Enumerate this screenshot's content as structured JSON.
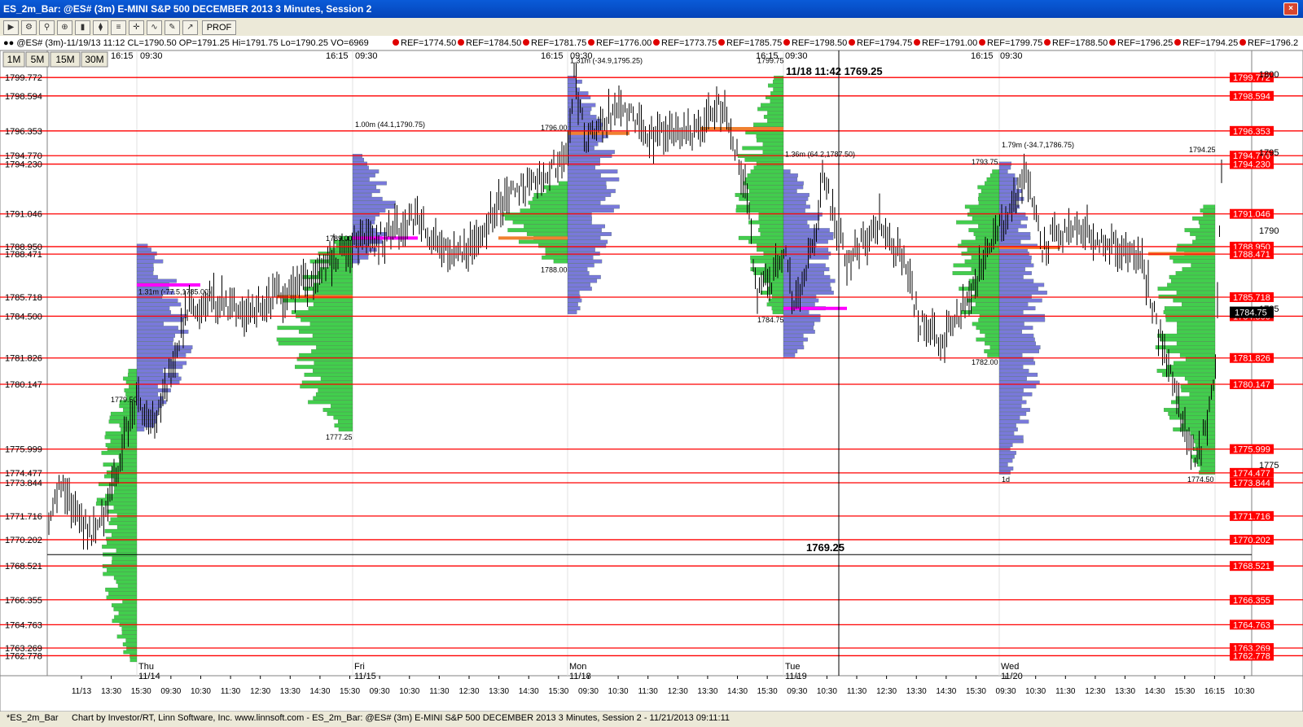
{
  "window": {
    "title": "ES_2m_Bar: @ES# (3m) E-MINI S&P 500 DECEMBER 2013 3 Minutes, Session 2",
    "close": "×"
  },
  "toolbar": {
    "icons": [
      "play-icon",
      "gear-icon",
      "search-icon",
      "magnify-icon",
      "bar-chart-icon",
      "candle-icon",
      "profile-icon",
      "crosshair-icon",
      "line-chart-icon",
      "draw-icon",
      "trend-icon"
    ],
    "prof_label": "PROF"
  },
  "chart": {
    "info_bar": "@ES# (3m)-11/19/13 11:12 CL=1790.50 OP=1791.25 Hi=1791.75 Lo=1790.25 VO=6969",
    "ref_labels": [
      "REF=1774.50",
      "REF=1784.50",
      "REF=1781.75",
      "REF=1776.00",
      "REF=1773.75",
      "REF=1785.75",
      "REF=1798.50",
      "REF=1794.75",
      "REF=1791.00",
      "REF=1799.75",
      "REF=1788.50",
      "REF=1796.25",
      "REF=1794.25",
      "REF=1796.2"
    ],
    "period_buttons": [
      "1M",
      "5M",
      "15M",
      "30M"
    ],
    "ylim": [
      1761.5,
      1801.5
    ],
    "colors": {
      "background": "#ffffff",
      "price_line": "#ff0000",
      "bars": "#000000",
      "profile_green": "#2ec83a",
      "profile_blue": "#6b6bd6",
      "poc_magenta": "#ff00ff",
      "value_area_orange": "#f08030",
      "highlight_label_bg": "#ff0000"
    },
    "levels_left": [
      "1799.772",
      "1798.594",
      "1796.353",
      "1794.770",
      "1794.230",
      "1791.046",
      "1788.950",
      "1788.471",
      "1785.718",
      "1784.500",
      "1781.826",
      "1780.147",
      "1775.999",
      "1774.477",
      "1773.844",
      "1771.716",
      "1770.202",
      "1768.521",
      "1766.355",
      "1764.763",
      "1763.269",
      "1762.778"
    ],
    "right_axis_ticks": [
      "1800",
      "1795",
      "1790",
      "1785",
      "1775"
    ],
    "current_price": "1784.75",
    "crosshair": {
      "label": "11/18 11:42",
      "price": "1769.25",
      "bottom_label": "1769.25"
    },
    "session_top_labels": [
      {
        "t": "16:15"
      },
      {
        "t": "09:30"
      },
      {
        "t": "16:15"
      },
      {
        "t": "09:30"
      },
      {
        "t": "16:15"
      },
      {
        "t": "09:30"
      },
      {
        "t": "16:15"
      },
      {
        "t": "09:30"
      },
      {
        "t": "16:15"
      },
      {
        "t": "09:30"
      }
    ],
    "profile_annotations": [
      "1.31m (-77.5,1785.00)",
      "1789.00",
      "1779.50",
      "1777.25",
      "1.00m (44.1,1790.75)",
      "1788.00",
      "1796.00",
      "1.31m (-34.9,1795.25)",
      "1799.75",
      "1.36m (64.2,1787.50)",
      "1784.75",
      "1.79m (-34.7,1786.75)",
      "1793.75",
      "1794.25",
      "1782.00",
      "1774.50",
      "1d"
    ],
    "day_labels": [
      {
        "day": "Thu",
        "date": "11/14"
      },
      {
        "day": "Fri",
        "date": "11/15"
      },
      {
        "day": "Mon",
        "date": "11/18"
      },
      {
        "day": "Tue",
        "date": "11/19"
      },
      {
        "day": "Wed",
        "date": "11/20"
      }
    ],
    "x_ticks": [
      "11/13",
      "13:30",
      "15:30",
      "09:30",
      "10:30",
      "11:30",
      "12:30",
      "13:30",
      "14:30",
      "15:30",
      "09:30",
      "10:30",
      "11:30",
      "12:30",
      "13:30",
      "14:30",
      "15:30",
      "09:30",
      "10:30",
      "11:30",
      "12:30",
      "13:30",
      "14:30",
      "15:30",
      "09:30",
      "10:30",
      "11:30",
      "12:30",
      "13:30",
      "14:30",
      "15:30",
      "09:30",
      "10:30",
      "11:30",
      "12:30",
      "13:30",
      "14:30",
      "15:30",
      "16:15",
      "10:30"
    ]
  },
  "footer": {
    "tab": "*ES_2m_Bar",
    "credit": "Chart by Investor/RT, Linn Software, Inc. www.linnsoft.com - ES_2m_Bar: @ES# (3m) E-MINI S&P 500 DECEMBER 2013 3 Minutes, Session 2 - 11/21/2013 09:11:11"
  }
}
